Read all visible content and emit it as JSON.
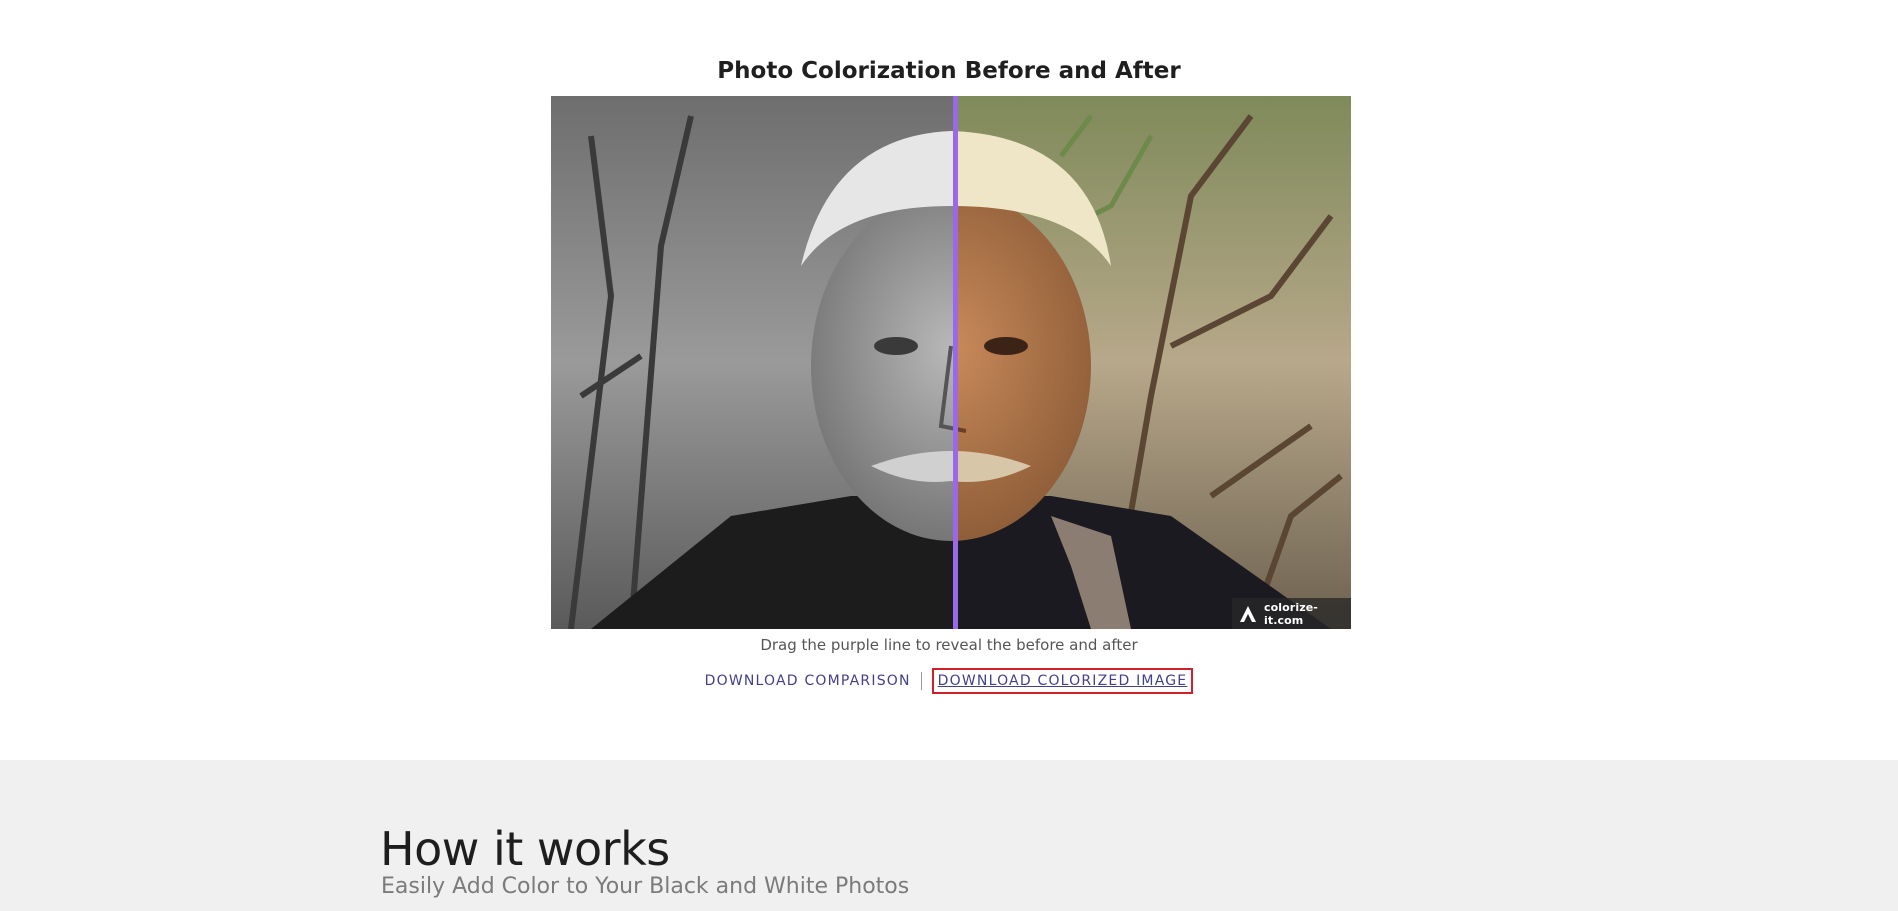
{
  "page": {
    "title": "Photo Colorization Before and After",
    "caption": "Drag the purple line to reveal the before and after"
  },
  "comparison": {
    "watermark": "colorize-it.com",
    "slider_color": "#9b69e8",
    "slider_position": 0.505
  },
  "actions": {
    "download_comparison": "DOWNLOAD COMPARISON",
    "download_colorized": "DOWNLOAD COLORIZED IMAGE"
  },
  "how_it_works": {
    "title": "How it works",
    "subtitle": "Easily Add Color to Your Black and White Photos"
  },
  "colors": {
    "link": "#433f8c",
    "highlight_border": "#d21f2a",
    "section_bg": "#f0f0f0"
  }
}
